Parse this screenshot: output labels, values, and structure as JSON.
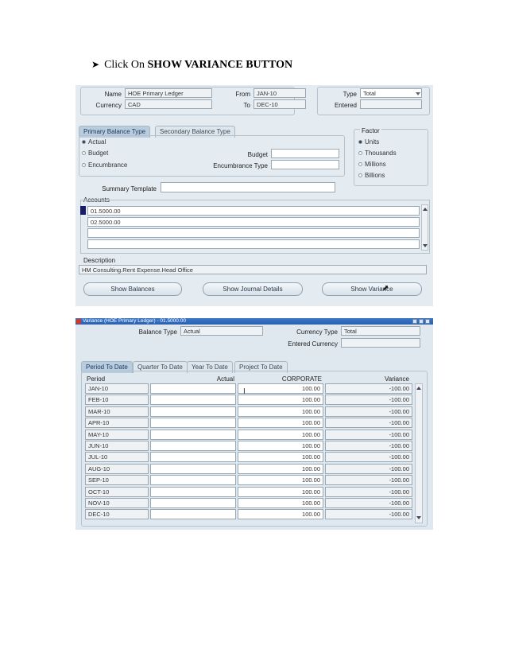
{
  "heading": {
    "prefix": "Click On ",
    "bold": "SHOW VARIANCE BUTTON"
  },
  "top": {
    "name_label": "Name",
    "name_value": "HOE Primary Ledger",
    "currency_label": "Currency",
    "currency_value": "CAD",
    "from_label": "From",
    "from_value": "JAN-10",
    "to_label": "To",
    "to_value": "DEC-10",
    "type_label": "Type",
    "type_value": "Total",
    "entered_label": "Entered",
    "entered_value": "",
    "tabs": [
      "Primary Balance Type",
      "Secondary Balance Type"
    ],
    "balance_types": [
      "Actual",
      "Budget",
      "Encumbrance"
    ],
    "budget_label": "Budget",
    "encumbrance_type_label": "Encumbrance Type",
    "factor_label": "Factor",
    "factors": [
      "Units",
      "Thousands",
      "Millions",
      "Billions"
    ],
    "summary_template_label": "Summary Template",
    "accounts_label": "Accounts",
    "accounts": [
      "01.5000.00",
      "02.5000.00",
      "",
      ""
    ],
    "description_label": "Description",
    "description_value": "HM Consulting.Rent Expense.Head Office",
    "buttons": [
      "Show Balances",
      "Show Journal Details",
      "Show Variance"
    ]
  },
  "variance": {
    "window_title": "Variance (HOE Primary Ledger) - 01.5000.00",
    "balance_type_label": "Balance Type",
    "balance_type_value": "Actual",
    "currency_type_label": "Currency Type",
    "currency_type_value": "Total",
    "entered_currency_label": "Entered Currency",
    "entered_currency_value": "",
    "tabs": [
      "Period To Date",
      "Quarter To Date",
      "Year To Date",
      "Project To Date"
    ],
    "columns": [
      "Period",
      "Actual",
      "CORPORATE",
      "Variance"
    ],
    "rows": [
      {
        "period": "JAN-10",
        "actual": "",
        "corporate": "100.00",
        "variance": "-100.00"
      },
      {
        "period": "FEB-10",
        "actual": "",
        "corporate": "100.00",
        "variance": "-100.00"
      },
      {
        "period": "MAR-10",
        "actual": "",
        "corporate": "100.00",
        "variance": "-100.00"
      },
      {
        "period": "APR-10",
        "actual": "",
        "corporate": "100.00",
        "variance": "-100.00"
      },
      {
        "period": "MAY-10",
        "actual": "",
        "corporate": "100.00",
        "variance": "-100.00"
      },
      {
        "period": "JUN-10",
        "actual": "",
        "corporate": "100.00",
        "variance": "-100.00"
      },
      {
        "period": "JUL-10",
        "actual": "",
        "corporate": "100.00",
        "variance": "-100.00"
      },
      {
        "period": "AUG-10",
        "actual": "",
        "corporate": "100.00",
        "variance": "-100.00"
      },
      {
        "period": "SEP-10",
        "actual": "",
        "corporate": "100.00",
        "variance": "-100.00"
      },
      {
        "period": "OCT-10",
        "actual": "",
        "corporate": "100.00",
        "variance": "-100.00"
      },
      {
        "period": "NOV-10",
        "actual": "",
        "corporate": "100.00",
        "variance": "-100.00"
      },
      {
        "period": "DEC-10",
        "actual": "",
        "corporate": "100.00",
        "variance": "-100.00"
      }
    ]
  }
}
